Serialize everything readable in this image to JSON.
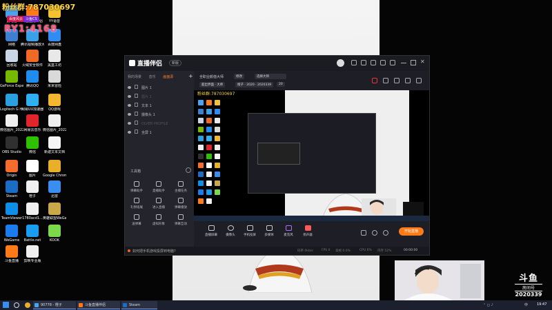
{
  "overlay": {
    "fans": "粉丝群:",
    "fans_number": "787030697",
    "badge_1": "百度风云",
    "badge_2": "斗鱼CS",
    "ry": "RY1:4168"
  },
  "desktop_icons": [
    {
      "label": "此电脑",
      "icon": "computer-icon",
      "color": "#4aa3f0"
    },
    {
      "label": "斗鱼直播伴侣",
      "icon": "douyu-companion-icon",
      "color": "#ff7a18"
    },
    {
      "label": "YY语音",
      "icon": "yy-icon",
      "color": "#f2c230"
    },
    {
      "label": "网络",
      "icon": "network-icon",
      "color": "#3d7fd0"
    },
    {
      "label": "腾讯视频播放大师",
      "icon": "video-icon",
      "color": "#3aa0e8"
    },
    {
      "label": "百度网盘",
      "icon": "baidu-pan-icon",
      "color": "#2f8cf0"
    },
    {
      "label": "回收站",
      "icon": "recycle-bin-icon",
      "color": "#c8d6e6"
    },
    {
      "label": "火绒安全软件",
      "icon": "huorong-icon",
      "color": "#f06a25"
    },
    {
      "label": "黑盒工坊",
      "icon": "heihe-icon",
      "color": "#e8e8e8"
    },
    {
      "label": "GeForce Experience",
      "icon": "nvidia-icon",
      "color": "#76b900"
    },
    {
      "label": "腾讯QQ",
      "icon": "qq-icon",
      "color": "#1f8df0"
    },
    {
      "label": "米米冒险",
      "icon": "game-icon",
      "color": "#d9d9d9"
    },
    {
      "label": "Logitech G HUB",
      "icon": "logitech-icon",
      "color": "#2aa0e0"
    },
    {
      "label": "网易UU加速器",
      "icon": "uu-icon",
      "color": "#2fb0f0"
    },
    {
      "label": "QQ游戏",
      "icon": "qq-game-icon",
      "color": "#f2b830"
    },
    {
      "label": "微信图片_2022111...",
      "icon": "image-file-icon",
      "color": "#f0f0f0"
    },
    {
      "label": "网易云音乐",
      "icon": "netease-music-icon",
      "color": "#e0262a"
    },
    {
      "label": "微信图片_2022091...",
      "icon": "image-file-icon",
      "color": "#f0f0f0"
    },
    {
      "label": "OBS Studio",
      "icon": "obs-icon",
      "color": "#303030"
    },
    {
      "label": "微信",
      "icon": "wechat-icon",
      "color": "#2dc100"
    },
    {
      "label": "新建文本文档",
      "icon": "text-file-icon",
      "color": "#f5f5f5"
    },
    {
      "label": "Origin",
      "icon": "origin-icon",
      "color": "#f56c2d"
    },
    {
      "label": "图片",
      "icon": "image-folder-icon",
      "color": "#ffffff"
    },
    {
      "label": "Google Chrome",
      "icon": "chrome-icon",
      "color": "#e8b02a"
    },
    {
      "label": "Steam",
      "icon": "steam-icon",
      "color": "#1b6cc4"
    },
    {
      "label": "橙子",
      "icon": "orange-file-icon",
      "color": "#f0f0f0"
    },
    {
      "label": "迅雷",
      "icon": "xunlei-icon",
      "color": "#3a8ef0"
    },
    {
      "label": "TeamViewer",
      "icon": "teamviewer-icon",
      "color": "#0e8ee9"
    },
    {
      "label": "1780acd1...",
      "icon": "image-file-icon",
      "color": "#f0f0f0"
    },
    {
      "label": "英雄联盟WeGame版",
      "icon": "lol-icon",
      "color": "#c9a84a"
    },
    {
      "label": "WeGame",
      "icon": "wegame-icon",
      "color": "#1b7cf0"
    },
    {
      "label": "Battle.net",
      "icon": "battlenet-icon",
      "color": "#1a9cf0"
    },
    {
      "label": "KOOK",
      "icon": "kook-icon",
      "color": "#7bd94a"
    },
    {
      "label": "斗鱼直播",
      "icon": "douyu-icon",
      "color": "#ff7a18"
    },
    {
      "label": "剪映专业版",
      "icon": "jianying-icon",
      "color": "#f0f0f0"
    }
  ],
  "app": {
    "title": "直播伴侣",
    "version": "新版",
    "left_tabs": [
      "我的场景",
      "音乐",
      "画面源"
    ],
    "sources": [
      {
        "label": "图片 1",
        "dim": false
      },
      {
        "label": "图片 1",
        "dim": true
      },
      {
        "label": "文本 1",
        "dim": false
      },
      {
        "label": "摄像头 1",
        "dim": false
      },
      {
        "label": "OLVER PROFILE",
        "dim": true
      },
      {
        "label": "全屏 1",
        "dim": false
      }
    ],
    "tools_title": "工具箱",
    "tools": [
      "弹幕助手",
      "直播助手",
      "主播任务",
      "礼物墙展",
      "进入直播",
      "弹幕播放",
      "送弹幕",
      "虚拟形象",
      "弹幕互动"
    ],
    "scene_label_1": "全职业颜值大师",
    "scene_label_2": "修改",
    "scene_label_3": "选择大师",
    "chip_1": "超出界面 · 大师",
    "chip_2": "橙子 · 2020 · 2020339",
    "chip_3": "20",
    "preview_fans": "粉丝群:",
    "preview_fans_number": "787030697",
    "controls": [
      "直播屏幕",
      "摄像头",
      "手机投屏",
      "多媒体",
      "麦克风",
      "扬声器"
    ],
    "live_button": "开始直播",
    "status_message": "如何把手机游戏投屏到电脑?",
    "stats": [
      "码率 0kb/s",
      "FPS 0",
      "丢帧 0.0%",
      "CPU 6%",
      "内存 52%",
      "00:00:00"
    ]
  },
  "douyu": {
    "logo": "斗鱼",
    "room_label": "房间号",
    "room_number": "2020339"
  },
  "taskbar": {
    "search_placeholder": "",
    "tasks": [
      "90778 - 橙子",
      "斗鱼直播伴侣",
      "Steam"
    ],
    "task_colors": [
      "#4aa3f0",
      "#ff7a18",
      "#1b6cc4"
    ],
    "clock": "19:47",
    "tray_lang": "中"
  }
}
